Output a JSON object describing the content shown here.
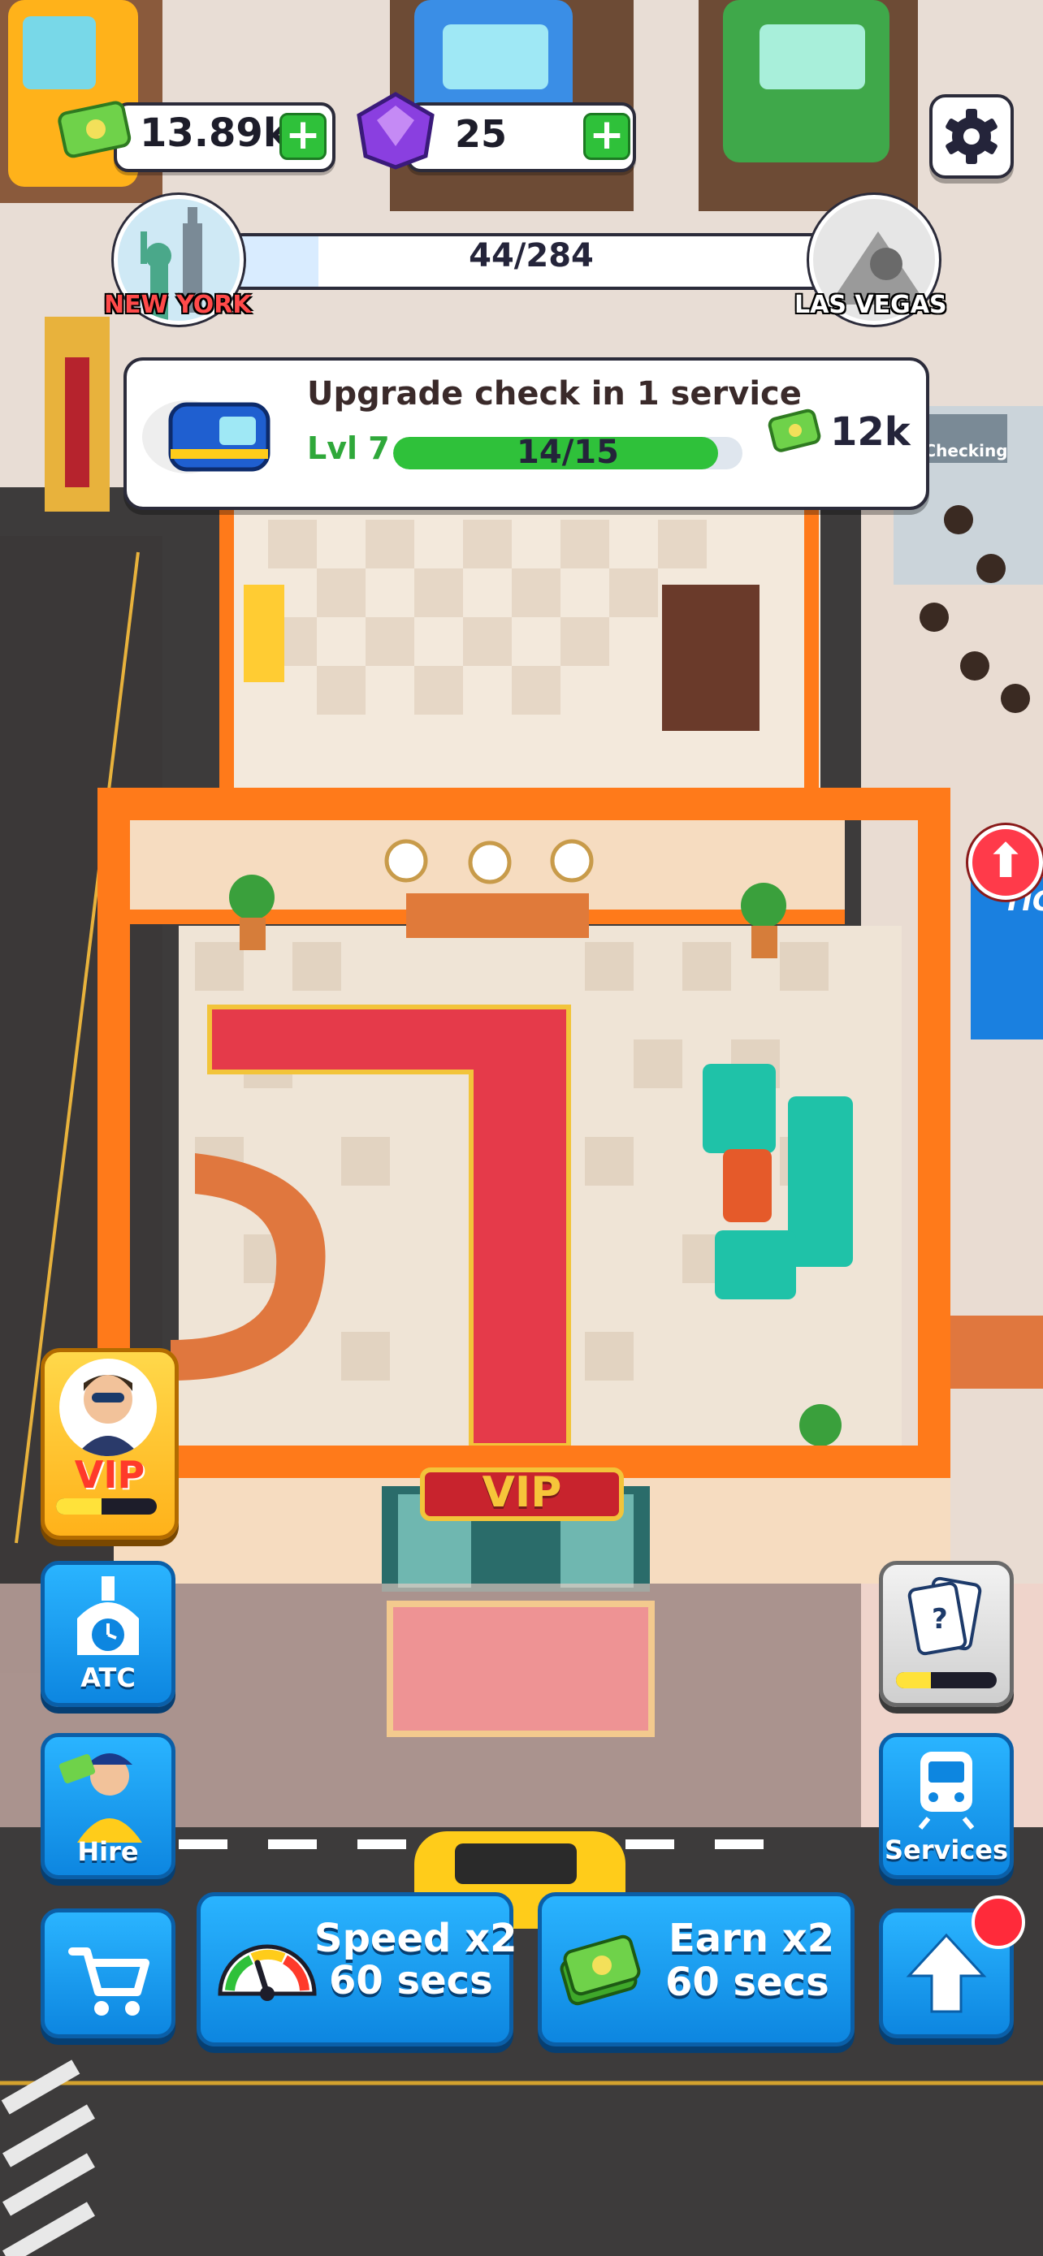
{
  "currency": {
    "cash": "13.89k",
    "gems": "25",
    "plus": "+"
  },
  "route": {
    "from": "NEW YORK",
    "to": "LAS VEGAS",
    "progress_text": "44/284",
    "progress": 0.155
  },
  "upgrade_panel": {
    "title": "Upgrade check in 1 service",
    "level": "Lvl 7",
    "progress_text": "14/15",
    "progress": 0.93,
    "cost": "12k"
  },
  "scene": {
    "vip_sign": "VIP",
    "checking_sign": "Checking",
    "ticket_sign": "TIC"
  },
  "side_buttons": {
    "vip": "VIP",
    "vip_progress": 0.45,
    "atc": "ATC",
    "hire": "Hire",
    "services": "Services",
    "card_progress": 0.35
  },
  "boosts": {
    "speed": {
      "line1": "Speed x2",
      "line2": "60 secs"
    },
    "earn": {
      "line1": "Earn x2",
      "line2": "60 secs"
    }
  },
  "colors": {
    "accent_blue": "#0d86e0",
    "green": "#2fc13a",
    "orange": "#ff7a1a",
    "vip_red": "#e53a4a"
  }
}
